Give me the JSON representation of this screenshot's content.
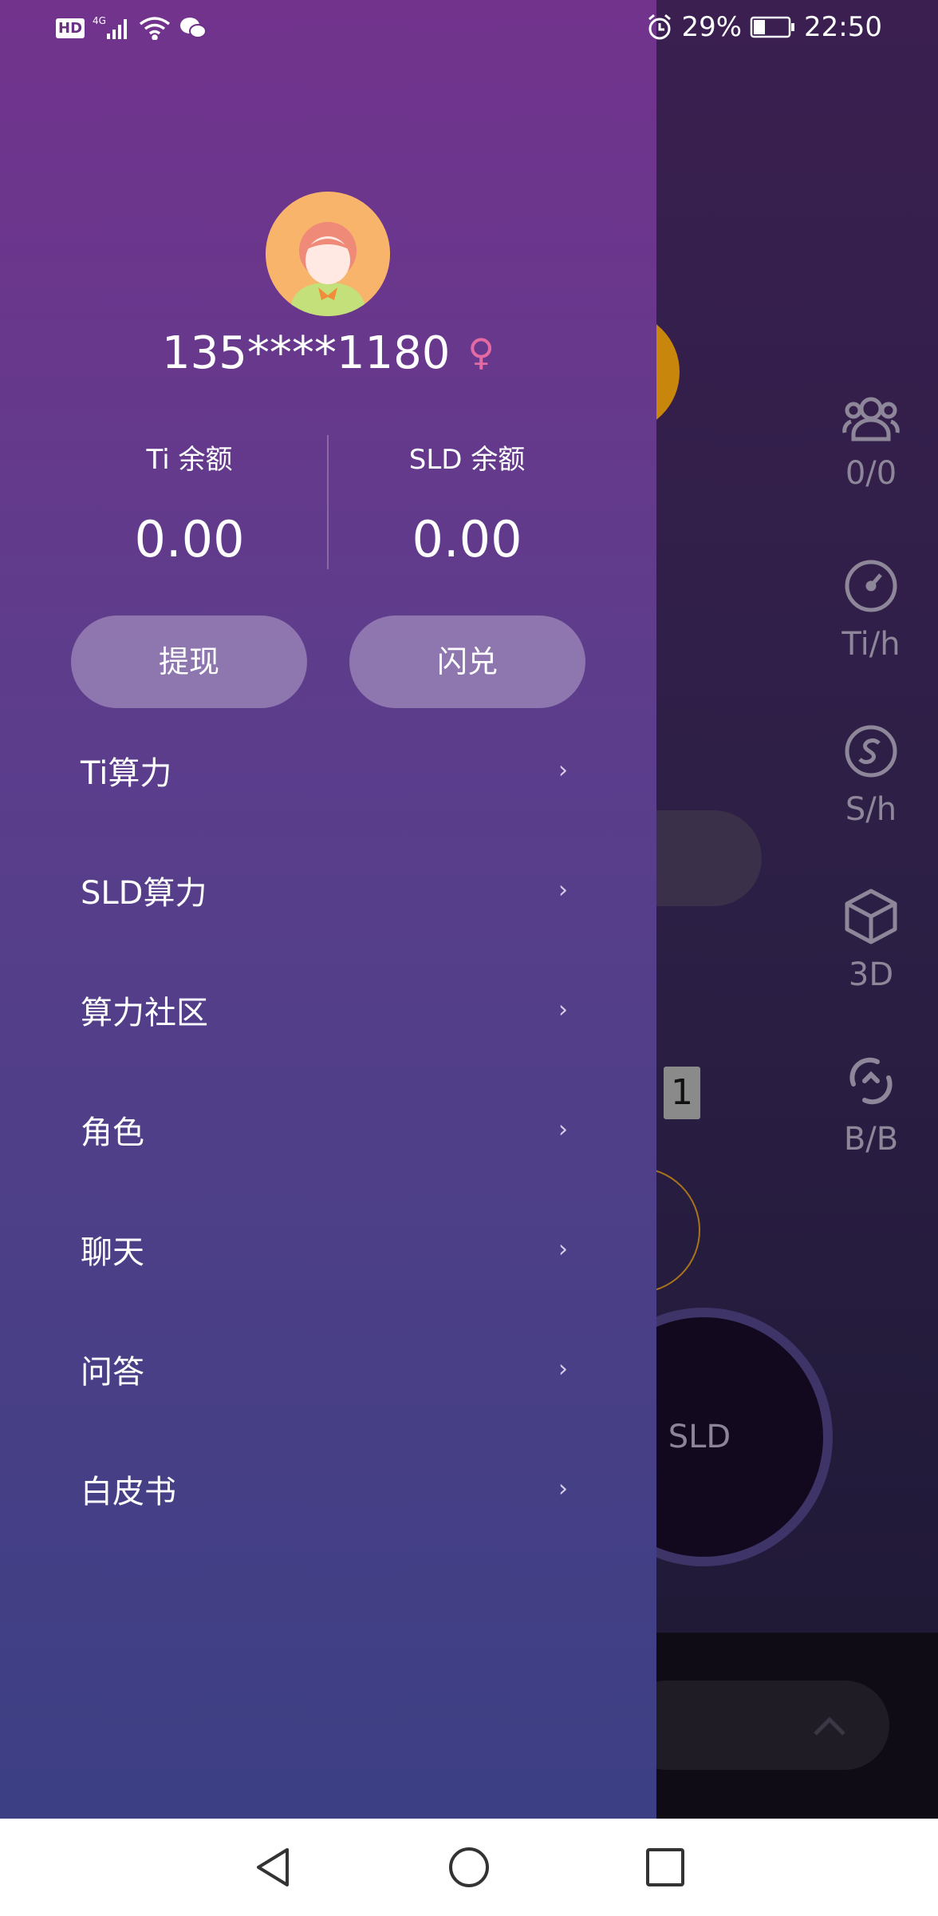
{
  "status_bar": {
    "battery_percent": "29%",
    "time": "22:50",
    "network": "4G",
    "hd_badge": "HD",
    "icons": [
      "hd-icon",
      "signal-icon",
      "wifi-icon",
      "wechat-icon",
      "alarm-icon",
      "battery-icon"
    ]
  },
  "background_app": {
    "side_stats": [
      {
        "icon": "users-icon",
        "label": "0/0"
      },
      {
        "icon": "speedometer-icon",
        "label": "Ti/h"
      },
      {
        "icon": "s-coin-icon",
        "label": "S/h"
      },
      {
        "icon": "cube-icon",
        "label": "3D"
      },
      {
        "icon": "refresh-icon",
        "label": "B/B"
      }
    ],
    "counter": "1",
    "sld_button": "SLD"
  },
  "drawer": {
    "user": {
      "phone": "135****1180",
      "gender_symbol": "♀",
      "gender_color": "#e46aa3"
    },
    "balances": [
      {
        "label": "Ti 余额",
        "value": "0.00"
      },
      {
        "label": "SLD 余额",
        "value": "0.00"
      }
    ],
    "actions": {
      "withdraw": "提现",
      "exchange": "闪兑"
    },
    "menu": [
      {
        "label": "Ti算力"
      },
      {
        "label": "SLD算力"
      },
      {
        "label": "算力社区"
      },
      {
        "label": "角色"
      },
      {
        "label": "聊天"
      },
      {
        "label": "问答"
      },
      {
        "label": "白皮书"
      }
    ],
    "chevron": "›"
  },
  "nav_bar": {
    "buttons": [
      "back-icon",
      "home-icon",
      "recents-icon"
    ]
  },
  "colors": {
    "drawer_top": "#72338d",
    "drawer_bottom": "#3c3f84",
    "avatar_bg": "#f8b46b",
    "orb": "#c9860d"
  }
}
